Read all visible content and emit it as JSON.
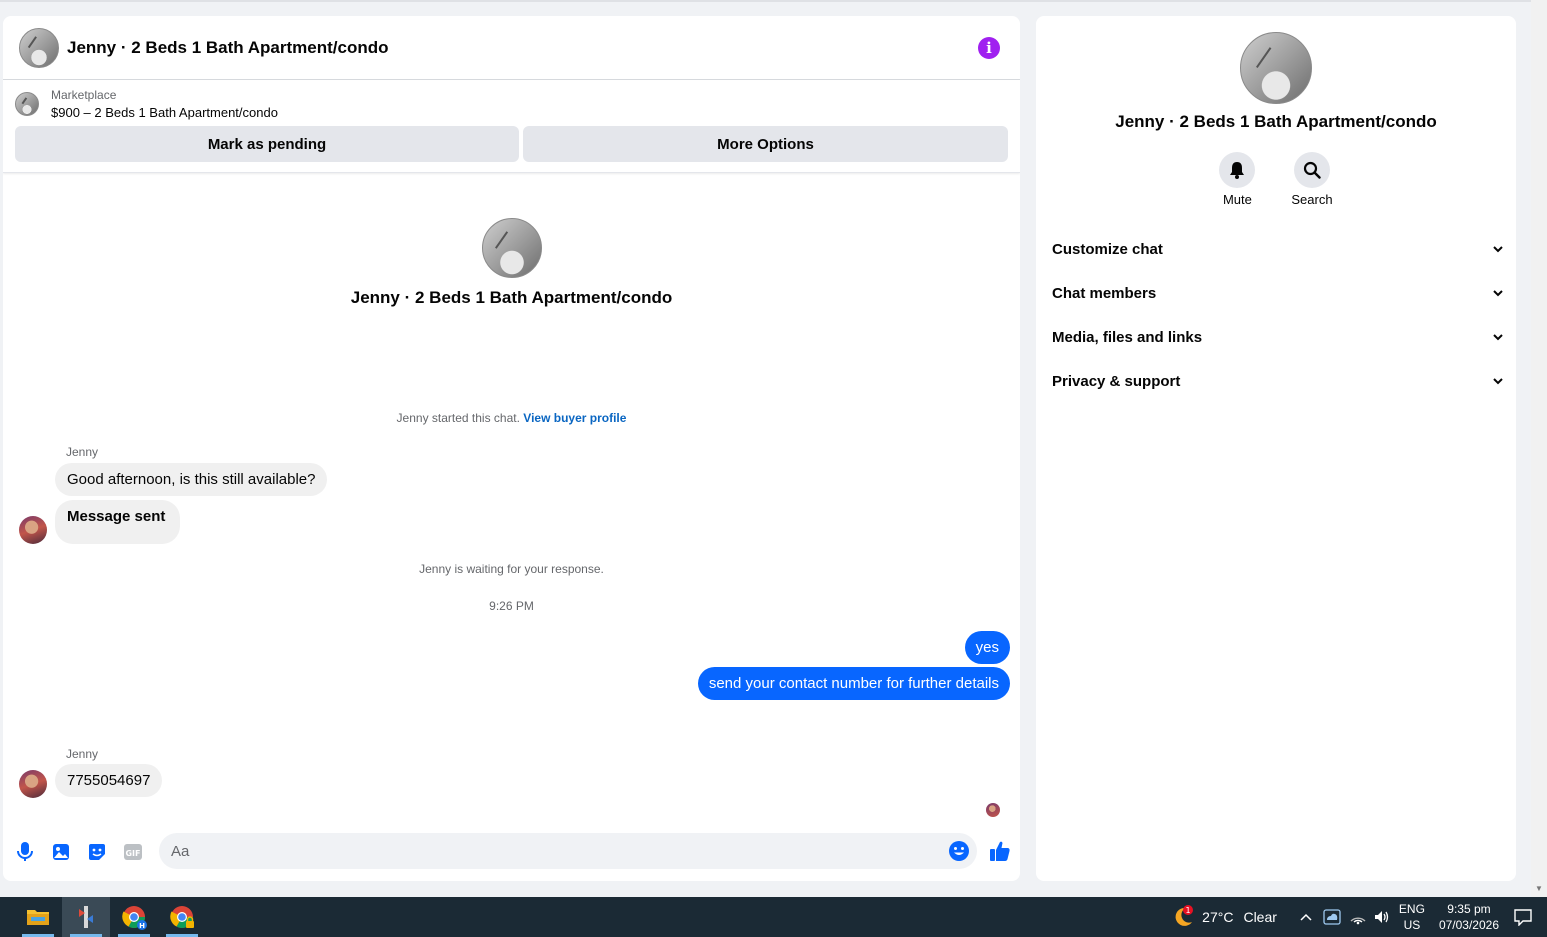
{
  "chat": {
    "title": "Jenny · 2 Beds 1 Bath Apartment/condo",
    "marketplace_label": "Marketplace",
    "listing": "$900 – 2 Beds 1 Bath Apartment/condo",
    "mark_pending": "Mark as pending",
    "more_options": "More Options",
    "conversation_title": "Jenny · 2 Beds 1 Bath Apartment/condo",
    "started_text": "Jenny started this chat.",
    "view_buyer": "View buyer profile",
    "waiting_text": "Jenny is waiting for your response.",
    "timestamp": "9:26 PM",
    "messages": [
      {
        "sender": "Jenny",
        "text": "Good afternoon, is this still available?"
      },
      {
        "text": "Message sent"
      },
      {
        "text": "yes"
      },
      {
        "text": "send your contact number for further details"
      },
      {
        "sender": "Jenny",
        "text": "7755054697"
      }
    ],
    "input_placeholder": "Aa"
  },
  "info": {
    "title": "Jenny · 2 Beds 1 Bath Apartment/condo",
    "mute": "Mute",
    "search": "Search",
    "sections": [
      "Customize chat",
      "Chat members",
      "Media, files and links",
      "Privacy & support"
    ]
  },
  "taskbar": {
    "weather_temp": "27°C",
    "weather_cond": "Clear",
    "weather_badge": "1",
    "lang_top": "ENG",
    "lang_bottom": "US",
    "time": "9:35 pm",
    "date": "07/03/2026",
    "app_badge": "H"
  },
  "colors": {
    "accent": "#0866ff",
    "info": "#a020f0"
  }
}
